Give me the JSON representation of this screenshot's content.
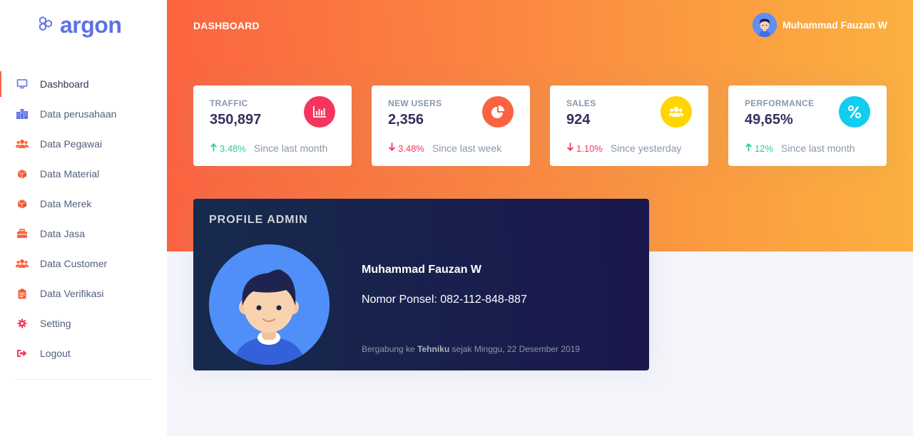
{
  "brand": {
    "name": "argon",
    "icon": "hexagons-logo"
  },
  "sidebar": {
    "items": [
      {
        "label": "Dashboard",
        "icon": "monitor-icon",
        "color": "#5e72e4",
        "active": true
      },
      {
        "label": "Data perusahaan",
        "icon": "building-icon",
        "color": "#5e72e4"
      },
      {
        "label": "Data Pegawai",
        "icon": "users-icon",
        "color": "#fb6340"
      },
      {
        "label": "Data Material",
        "icon": "cube-icon",
        "color": "#fb6340"
      },
      {
        "label": "Data Merek",
        "icon": "cube-icon",
        "color": "#fb6340"
      },
      {
        "label": "Data Jasa",
        "icon": "briefcase-icon",
        "color": "#fb6340"
      },
      {
        "label": "Data Customer",
        "icon": "users-icon",
        "color": "#fb6340"
      },
      {
        "label": "Data Verifikasi",
        "icon": "clipboard-icon",
        "color": "#fb6340"
      },
      {
        "label": "Setting",
        "icon": "gear-icon",
        "color": "#f5365c"
      },
      {
        "label": "Logout",
        "icon": "logout-icon",
        "color": "#f5365c"
      }
    ]
  },
  "header": {
    "title": "DASHBOARD",
    "user_name": "Muhammad Fauzan W",
    "gradient": [
      "#fb6340",
      "#fbb140"
    ]
  },
  "stats": [
    {
      "title": "TRAFFIC",
      "value": "350,897",
      "delta": "3.48%",
      "direction": "up",
      "since": "Since last month",
      "icon": "bar-chart-icon",
      "icon_bg": "#f5365c"
    },
    {
      "title": "NEW USERS",
      "value": "2,356",
      "delta": "3.48%",
      "direction": "down",
      "since": "Since last week",
      "icon": "pie-chart-icon",
      "icon_bg": "#fb6340"
    },
    {
      "title": "SALES",
      "value": "924",
      "delta": "1.10%",
      "direction": "down",
      "since": "Since yesterday",
      "icon": "users-icon",
      "icon_bg": "#ffd600"
    },
    {
      "title": "PERFORMANCE",
      "value": "49,65%",
      "delta": "12%",
      "direction": "up",
      "since": "Since last month",
      "icon": "percent-icon",
      "icon_bg": "#11cdef"
    }
  ],
  "profile": {
    "heading": "PROFILE ADMIN",
    "name": "Muhammad Fauzan W",
    "phone": "Nomor Ponsel: 082-112-848-887",
    "joined_prefix": "Bergabung ke ",
    "joined_company": "Tehniku",
    "joined_suffix": " sejak Minggu, 22 Desember 2019"
  }
}
